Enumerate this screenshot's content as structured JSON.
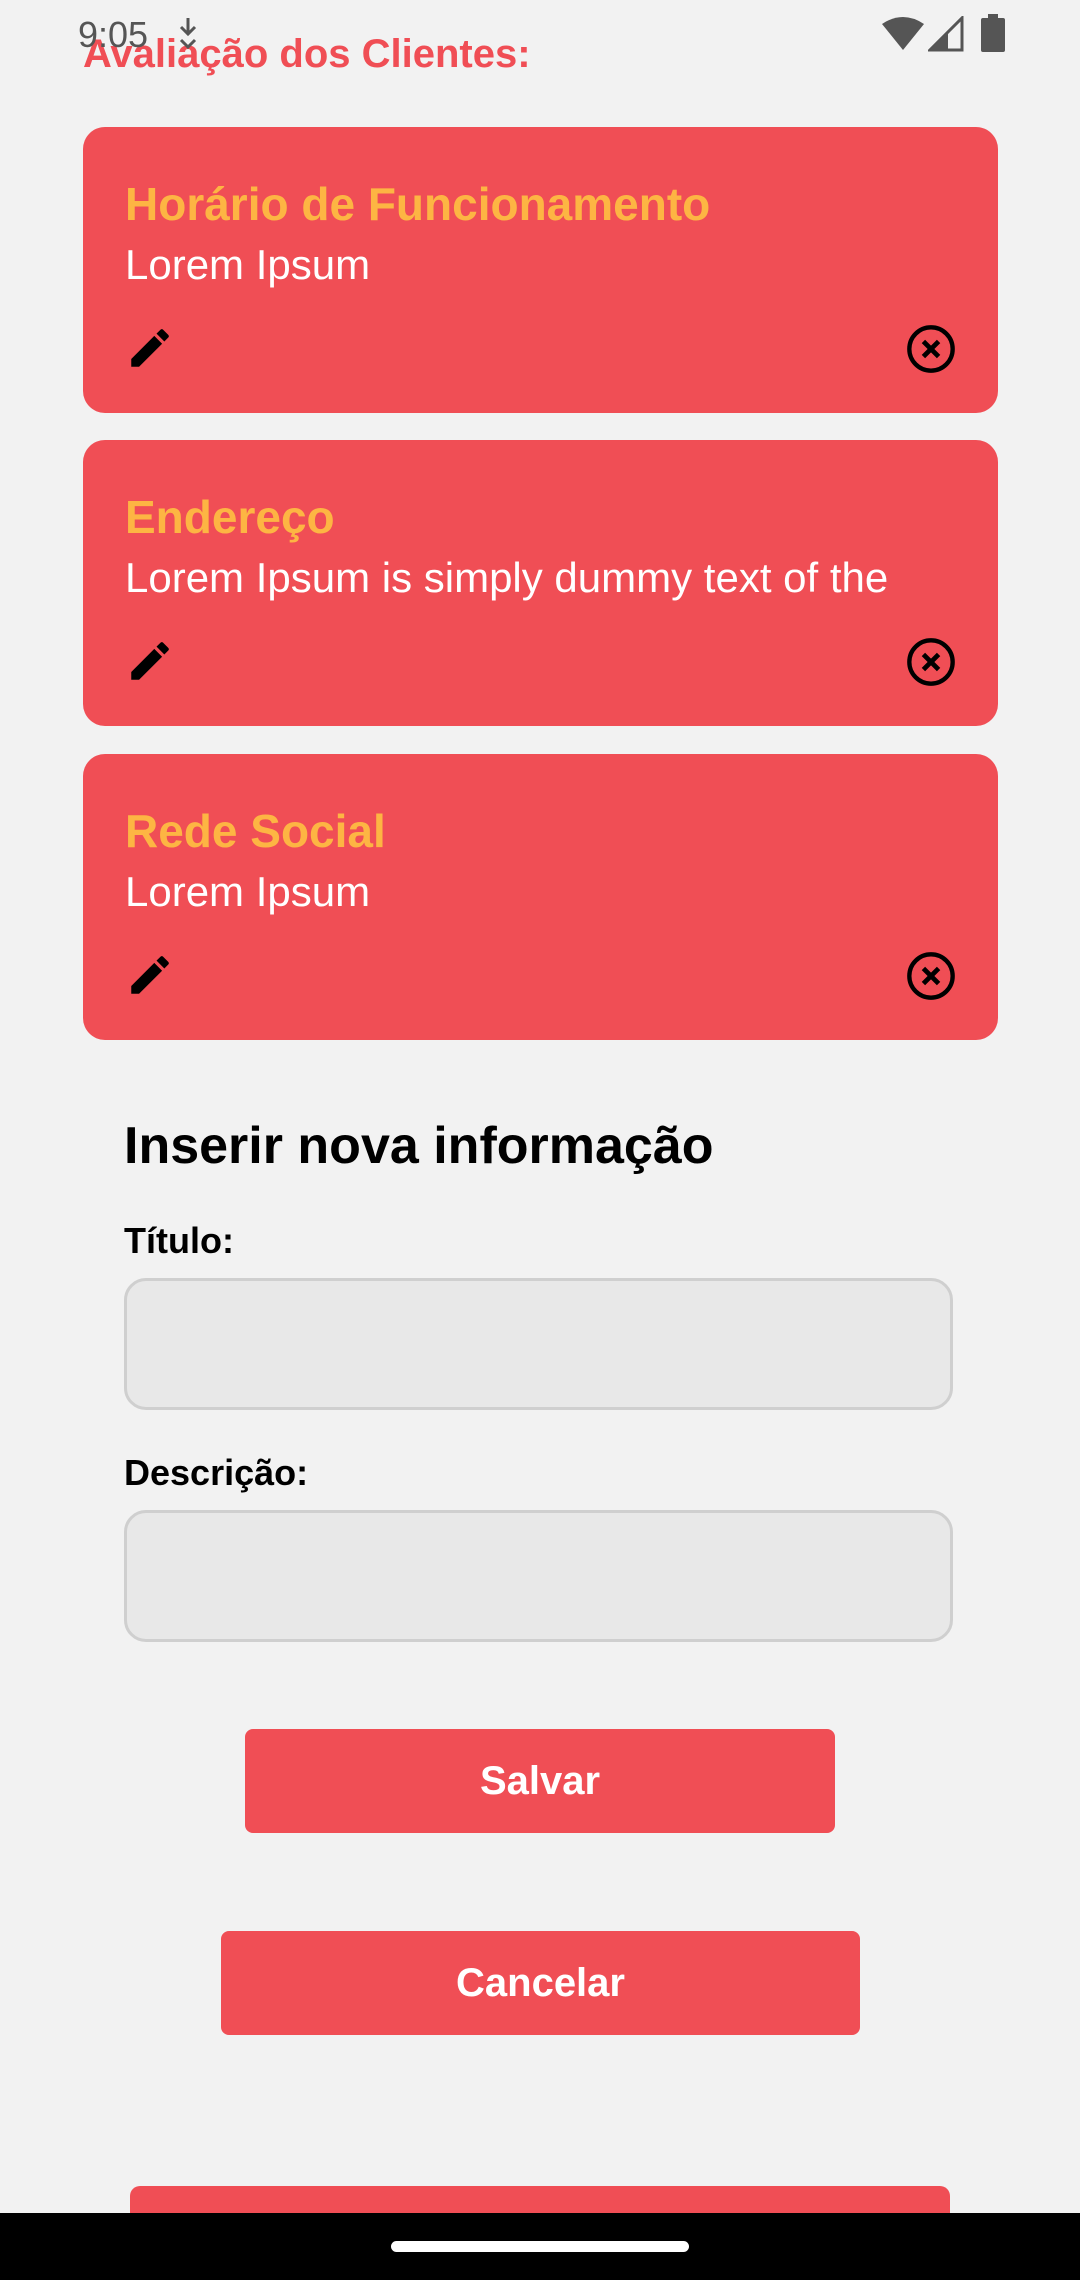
{
  "status_bar": {
    "time": "9:05",
    "icons": [
      "download-notification-icon",
      "wifi-icon",
      "cell-signal-icon",
      "battery-icon"
    ]
  },
  "section_title": "Avaliação dos Clientes:",
  "cards": [
    {
      "title": "Horário de Funcionamento",
      "description": "Lorem Ipsum",
      "edit_icon": "pencil-icon",
      "delete_icon": "close-circle-icon"
    },
    {
      "title": "Endereço",
      "description": "Lorem Ipsum is simply dummy text of the",
      "edit_icon": "pencil-icon",
      "delete_icon": "close-circle-icon"
    },
    {
      "title": "Rede Social",
      "description": "Lorem Ipsum",
      "edit_icon": "pencil-icon",
      "delete_icon": "close-circle-icon"
    }
  ],
  "form": {
    "heading": "Inserir nova informação",
    "title_label": "Título:",
    "title_value": "",
    "description_label": "Descrição:",
    "description_value": "",
    "save_label": "Salvar",
    "cancel_label": "Cancelar"
  },
  "colors": {
    "accent": "#f04e55",
    "card_title": "#fdb543",
    "background": "#f2f2f2"
  }
}
